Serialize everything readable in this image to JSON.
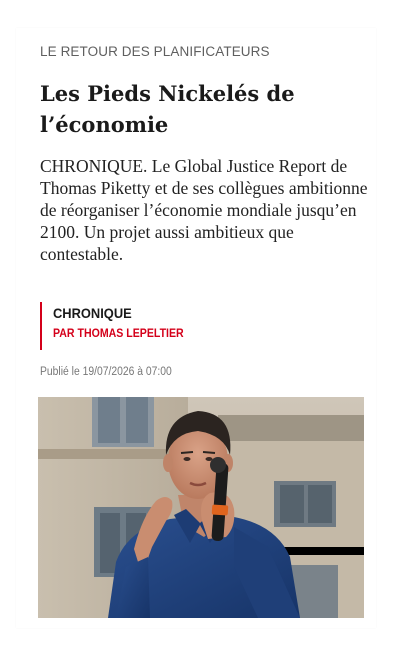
{
  "article": {
    "kicker": "LE RETOUR DES PLANIFICATEURS",
    "title": "Les Pieds Nickelés de l’économie",
    "lede": "CHRONIQUE. Le Global Justice Report de Thomas Piketty et de ses collègues ambitionne de réorganiser l’économie mondiale jusqu’en 2100. Un projet aussi ambitieux que contestable.",
    "byline": {
      "type": "CHRONIQUE",
      "author": "PAR THOMAS LEPELTIER"
    },
    "published": "Publié le 19/07/2026 à 07:00",
    "accent_color": "#d4001a"
  },
  "photo": {
    "subject": "man speaking into a microphone in front of a building"
  }
}
